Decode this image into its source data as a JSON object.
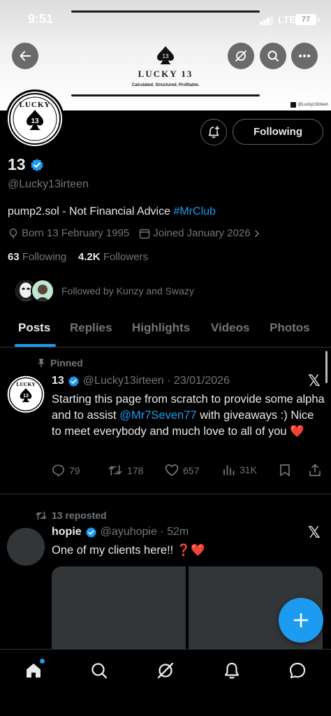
{
  "status_bar": {
    "time": "9:51",
    "network": "LTE",
    "battery": "77"
  },
  "banner": {
    "logo_number": "13",
    "title": "LUCKY 13",
    "subtitle": "Calculated. Structured. Profitable.",
    "watermark": "@Lucky13irteen"
  },
  "profile": {
    "avatar_text": "LUCKY",
    "avatar_number": "13",
    "name": "13",
    "handle": "@Lucky13irteen",
    "bio_text": "pump2.sol - Not Financial Advice ",
    "bio_hashtag": "#MrClub",
    "born": "Born 13 February 1995",
    "joined": "Joined January 2026",
    "following_count": "63",
    "following_label": "Following",
    "followers_count": "4.2K",
    "followers_label": "Followers",
    "followed_by": "Followed by Kunzy and Swazy",
    "following_button": "Following"
  },
  "tabs": [
    "Posts",
    "Replies",
    "Highlights",
    "Videos",
    "Photos"
  ],
  "pinned_post": {
    "pinned_label": "Pinned",
    "name": "13",
    "handle_date": "@Lucky13irteen · 23/01/2026",
    "text_before": "Starting this page from scratch to provide some alpha and to assist ",
    "mention": "@Mr7Seven77",
    "text_after": " with giveaways :) Nice to meet everybody and much love to all of you ❤️",
    "replies": "79",
    "reposts": "178",
    "likes": "657",
    "views": "31K"
  },
  "repost": {
    "repost_label": "13 reposted",
    "name": "hopie",
    "handle_time": "@ayuhopie · 52m",
    "text": "One of my clients here!! ❓❤️"
  },
  "colors": {
    "accent": "#1d9bf0",
    "background": "#000000",
    "muted": "#71767b"
  }
}
